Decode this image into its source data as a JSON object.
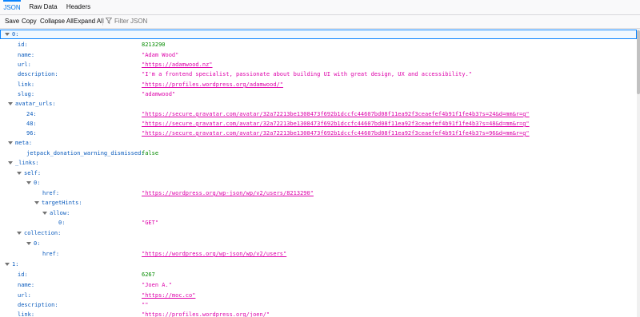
{
  "tabs": [
    {
      "label": "JSON"
    },
    {
      "label": "Raw Data"
    },
    {
      "label": "Headers"
    }
  ],
  "toolbar": {
    "save": "Save",
    "copy": "Copy",
    "collapse_all": "Collapse All",
    "expand_all": "Expand All",
    "filter_placeholder": "Filter JSON",
    "filter_icon": "funnel-icon"
  },
  "colors": {
    "key": "#0a5bbd",
    "string": "#dd00a9",
    "number": "#058b00",
    "accent": "#0a84ff"
  },
  "rows": [
    {
      "key": "0:",
      "expandable": true,
      "selected": true
    },
    {
      "key": "id:",
      "value": "8213290",
      "type": "num"
    },
    {
      "key": "name:",
      "value": "\"Adam Wood\"",
      "type": "str"
    },
    {
      "key": "url:",
      "value": "\"https://adamwood.nz\"",
      "type": "url"
    },
    {
      "key": "description:",
      "value": "\"I'm a frontend specialist, passionate about building UI with great design, UX and accessibility.\"",
      "type": "str"
    },
    {
      "key": "link:",
      "value": "\"https://profiles.wordpress.org/adamwood/\"",
      "type": "url"
    },
    {
      "key": "slug:",
      "value": "\"adamwood\"",
      "type": "str"
    },
    {
      "key": "avatar_urls:",
      "expandable": true
    },
    {
      "key": "24:",
      "value": "\"https://secure.gravatar.com/avatar/32a72213be1308473f692b1dccfc44607bd08f11ea92f3ceaefef4b91f1fe4b3?s=24&d=mm&r=g\"",
      "type": "url"
    },
    {
      "key": "48:",
      "value": "\"https://secure.gravatar.com/avatar/32a72213be1308473f692b1dccfc44607bd08f11ea92f3ceaefef4b91f1fe4b3?s=48&d=mm&r=g\"",
      "type": "url"
    },
    {
      "key": "96:",
      "value": "\"https://secure.gravatar.com/avatar/32a72213be1308473f692b1dccfc44607bd08f11ea92f3ceaefef4b91f1fe4b3?s=96&d=mm&r=g\"",
      "type": "url"
    },
    {
      "key": "meta:",
      "expandable": true
    },
    {
      "key": "jetpack_donation_warning_dismissed:",
      "value": "false",
      "type": "bool"
    },
    {
      "key": "_links:",
      "expandable": true
    },
    {
      "key": "self:",
      "expandable": true
    },
    {
      "key": "0:",
      "expandable": true
    },
    {
      "key": "href:",
      "value": "\"https://wordpress.org/wp-json/wp/v2/users/8213290\"",
      "type": "url"
    },
    {
      "key": "targetHints:",
      "expandable": true
    },
    {
      "key": "allow:",
      "expandable": true
    },
    {
      "key": "0:",
      "value": "\"GET\"",
      "type": "str"
    },
    {
      "key": "collection:",
      "expandable": true
    },
    {
      "key": "0:",
      "expandable": true
    },
    {
      "key": "href:",
      "value": "\"https://wordpress.org/wp-json/wp/v2/users\"",
      "type": "url"
    },
    {
      "key": "1:",
      "expandable": true
    },
    {
      "key": "id:",
      "value": "6267",
      "type": "num"
    },
    {
      "key": "name:",
      "value": "\"Joen A.\"",
      "type": "str"
    },
    {
      "key": "url:",
      "value": "\"https://moc.co\"",
      "type": "url"
    },
    {
      "key": "description:",
      "value": "\"\"",
      "type": "str"
    },
    {
      "key": "link:",
      "value": "\"https://profiles.wordpress.org/joen/\"",
      "type": "url"
    }
  ]
}
